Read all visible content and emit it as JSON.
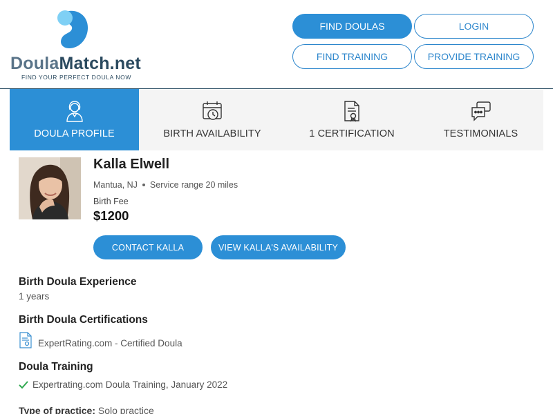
{
  "brand": {
    "name_part1": "Doula",
    "name_part2": "Match.net",
    "tagline": "FIND YOUR PERFECT DOULA NOW",
    "colors": {
      "accent": "#2c8fd6",
      "dark": "#2b4a5f",
      "light_blue": "#7fd0f5"
    }
  },
  "header": {
    "find_doulas": "FIND DOULAS",
    "login": "LOGIN",
    "find_training": "FIND TRAINING",
    "provide_training": "PROVIDE TRAINING"
  },
  "tabs": [
    {
      "label": "DOULA PROFILE",
      "icon": "doula-avatar-icon",
      "active": true
    },
    {
      "label": "BIRTH AVAILABILITY",
      "icon": "calendar-clock-icon",
      "active": false
    },
    {
      "label": "1 CERTIFICATION",
      "icon": "certificate-document-icon",
      "active": false
    },
    {
      "label": "TESTIMONIALS",
      "icon": "chat-bubbles-icon",
      "active": false
    }
  ],
  "profile": {
    "name": "Kalla Elwell",
    "location": "Mantua, NJ",
    "service_range": "Service range 20 miles",
    "fee_label": "Birth Fee",
    "fee": "$1200",
    "contact_button": "CONTACT KALLA",
    "availability_button": "VIEW KALLA'S AVAILABILITY"
  },
  "sections": {
    "experience_title": "Birth Doula Experience",
    "experience_value": "1 years",
    "certifications_title": "Birth Doula Certifications",
    "certification_item": "ExpertRating.com - Certified Doula",
    "training_title": "Doula Training",
    "training_item": "Expertrating.com Doula Training, January 2022",
    "practice_label": "Type of practice:",
    "practice_value": "Solo practice"
  }
}
